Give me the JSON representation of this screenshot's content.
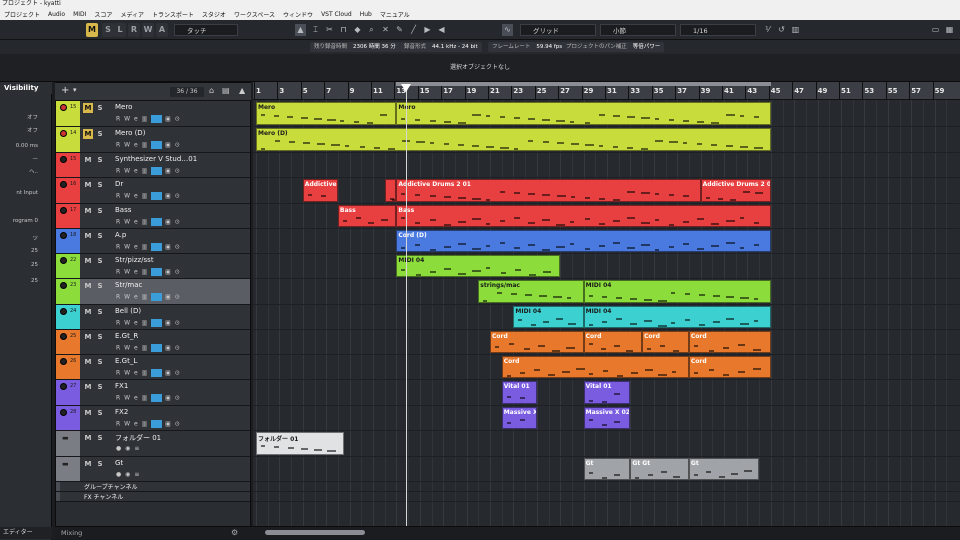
{
  "window": {
    "title": "プロジェクト - kyatti"
  },
  "menu": [
    "プロジェクト",
    "Audio",
    "MIDI",
    "スコア",
    "メディア",
    "トランスポート",
    "スタジオ",
    "ワークスペース",
    "ウィンドウ",
    "VST Cloud",
    "Hub",
    "マニュアル"
  ],
  "toolbar": {
    "buttons": [
      "M",
      "S",
      "L",
      "R",
      "W",
      "A"
    ],
    "automation_mode": "タッチ",
    "snap_type": "グリッド",
    "grid_type": "小節",
    "quantize": "1/16",
    "colors": {
      "button_on": "#d8b84a"
    }
  },
  "status": {
    "rec_time_label": "残り録音時間",
    "rec_time_value": "2306 時間 36 分",
    "rec_format_label": "録音形式",
    "rec_format_value": "44.1 kHz - 24 bit",
    "frame_rate_label": "フレームレート",
    "frame_rate_value": "59.94 fps",
    "pan_label": "プロジェクトのパン補正",
    "pan_value": "等倍パワー"
  },
  "info_line": "選択オブジェクトなし",
  "inspector": {
    "visibility": "Visibility",
    "rows": [
      "オフ",
      "オフ",
      "0.00 ms",
      "—",
      "ヘ..",
      "nt Input",
      "rogram 0",
      "ツ",
      "25",
      "25",
      "25"
    ],
    "bottom_label": "エディター"
  },
  "track_list": {
    "counter": "36 / 36",
    "footer_label": "Mixing"
  },
  "tracks": [
    {
      "num": "15",
      "name": "Mero",
      "type": "instrument",
      "color": "#c8dc3c",
      "m_on": true
    },
    {
      "num": "14",
      "name": "Mero (D)",
      "type": "instrument",
      "color": "#c8dc3c",
      "m_on": true
    },
    {
      "num": "15",
      "name": "Synthesizer V Stud…01",
      "type": "instrument",
      "color": "#e84040"
    },
    {
      "num": "16",
      "name": "Dr",
      "type": "instrument",
      "color": "#e84040"
    },
    {
      "num": "17",
      "name": "Bass",
      "type": "instrument",
      "color": "#e84040"
    },
    {
      "num": "18",
      "name": "A.p",
      "type": "instrument",
      "color": "#4a7ae0"
    },
    {
      "num": "22",
      "name": "Str/pizz/sst",
      "type": "instrument",
      "color": "#8cdc3c"
    },
    {
      "num": "23",
      "name": "Str/mac",
      "type": "instrument",
      "color": "#8cdc3c",
      "selected": true
    },
    {
      "num": "24",
      "name": "Bell (D)",
      "type": "instrument",
      "color": "#3cd0d0"
    },
    {
      "num": "25",
      "name": "E.Gt_R",
      "type": "instrument",
      "color": "#e8782c"
    },
    {
      "num": "26",
      "name": "E.Gt_L",
      "type": "instrument",
      "color": "#e8782c"
    },
    {
      "num": "27",
      "name": "FX1",
      "type": "instrument",
      "color": "#7a5ce0"
    },
    {
      "num": "28",
      "name": "FX2",
      "type": "instrument",
      "color": "#7a5ce0"
    },
    {
      "num": "",
      "name": "フォルダー 01",
      "type": "folder",
      "color": "#7a7e84"
    },
    {
      "num": "",
      "name": "Gt",
      "type": "folder",
      "color": "#7a7e84"
    },
    {
      "num": "",
      "name": "グループチャンネル",
      "type": "group",
      "color": "#4a4e54"
    },
    {
      "num": "",
      "name": "FX チャンネル",
      "type": "fx",
      "color": "#4a4e54"
    }
  ],
  "ruler_bars": [
    "1",
    "3",
    "5",
    "7",
    "9",
    "11",
    "13",
    "15",
    "17",
    "19",
    "21",
    "23",
    "25",
    "27",
    "29",
    "31",
    "33",
    "35",
    "37",
    "39",
    "41",
    "43",
    "45",
    "47",
    "49",
    "51",
    "53",
    "55",
    "57",
    "59"
  ],
  "parts": [
    {
      "lane": 0,
      "start": 1,
      "end": 13,
      "label": "Mero",
      "color": "#c8dc3c"
    },
    {
      "lane": 0,
      "start": 13,
      "end": 45,
      "label": "Mero",
      "color": "#c8dc3c"
    },
    {
      "lane": 1,
      "start": 1,
      "end": 45,
      "label": "Mero (D)",
      "color": "#c8dc3c"
    },
    {
      "lane": 3,
      "start": 5,
      "end": 8,
      "label": "Addictive D",
      "color": "#e84040"
    },
    {
      "lane": 3,
      "start": 12,
      "end": 13,
      "label": "",
      "color": "#e84040"
    },
    {
      "lane": 3,
      "start": 13,
      "end": 39,
      "label": "Addictive Drums 2 01",
      "color": "#e84040"
    },
    {
      "lane": 3,
      "start": 39,
      "end": 45,
      "label": "Addictive Drums 2 0",
      "color": "#e84040"
    },
    {
      "lane": 4,
      "start": 8,
      "end": 13,
      "label": "Bass",
      "color": "#e84040"
    },
    {
      "lane": 4,
      "start": 13,
      "end": 45,
      "label": "Bass",
      "color": "#e84040"
    },
    {
      "lane": 5,
      "start": 13,
      "end": 45,
      "label": "Cord (D)",
      "color": "#4a7ae0"
    },
    {
      "lane": 6,
      "start": 13,
      "end": 27,
      "label": "MIDI 04",
      "color": "#8cdc3c"
    },
    {
      "lane": 7,
      "start": 20,
      "end": 29,
      "label": "strings/mac",
      "color": "#8cdc3c"
    },
    {
      "lane": 7,
      "start": 29,
      "end": 45,
      "label": "MIDI 04",
      "color": "#8cdc3c"
    },
    {
      "lane": 8,
      "start": 23,
      "end": 29,
      "label": "MIDI 04",
      "color": "#3cd0d0"
    },
    {
      "lane": 8,
      "start": 29,
      "end": 45,
      "label": "MIDI 04",
      "color": "#3cd0d0"
    },
    {
      "lane": 9,
      "start": 21,
      "end": 29,
      "label": "Cord",
      "color": "#e8782c"
    },
    {
      "lane": 9,
      "start": 29,
      "end": 34,
      "label": "Cord",
      "color": "#e8782c"
    },
    {
      "lane": 9,
      "start": 34,
      "end": 38,
      "label": "Cord",
      "color": "#e8782c"
    },
    {
      "lane": 9,
      "start": 38,
      "end": 45,
      "label": "Cord",
      "color": "#e8782c"
    },
    {
      "lane": 10,
      "start": 22,
      "end": 38,
      "label": "Cord",
      "color": "#e8782c"
    },
    {
      "lane": 10,
      "start": 38,
      "end": 45,
      "label": "Cord",
      "color": "#e8782c"
    },
    {
      "lane": 11,
      "start": 22,
      "end": 25,
      "label": "Vital 01",
      "color": "#7a5ce0"
    },
    {
      "lane": 11,
      "start": 29,
      "end": 33,
      "label": "Vital 01",
      "color": "#7a5ce0"
    },
    {
      "lane": 12,
      "start": 22,
      "end": 25,
      "label": "Massive X 0",
      "color": "#7a5ce0"
    },
    {
      "lane": 12,
      "start": 29,
      "end": 33,
      "label": "Massive X 02",
      "color": "#7a5ce0"
    },
    {
      "lane": 13,
      "start": 1,
      "end": 8.5,
      "label": "フォルダー 01",
      "color": "#e0e2e4"
    },
    {
      "lane": 14,
      "start": 29,
      "end": 33,
      "label": "Gt",
      "color": "#a0a4a8"
    },
    {
      "lane": 14,
      "start": 33,
      "end": 38,
      "label": "Gt  Gt",
      "color": "#a0a4a8"
    },
    {
      "lane": 14,
      "start": 38,
      "end": 44,
      "label": "Gt",
      "color": "#a0a4a8"
    }
  ]
}
